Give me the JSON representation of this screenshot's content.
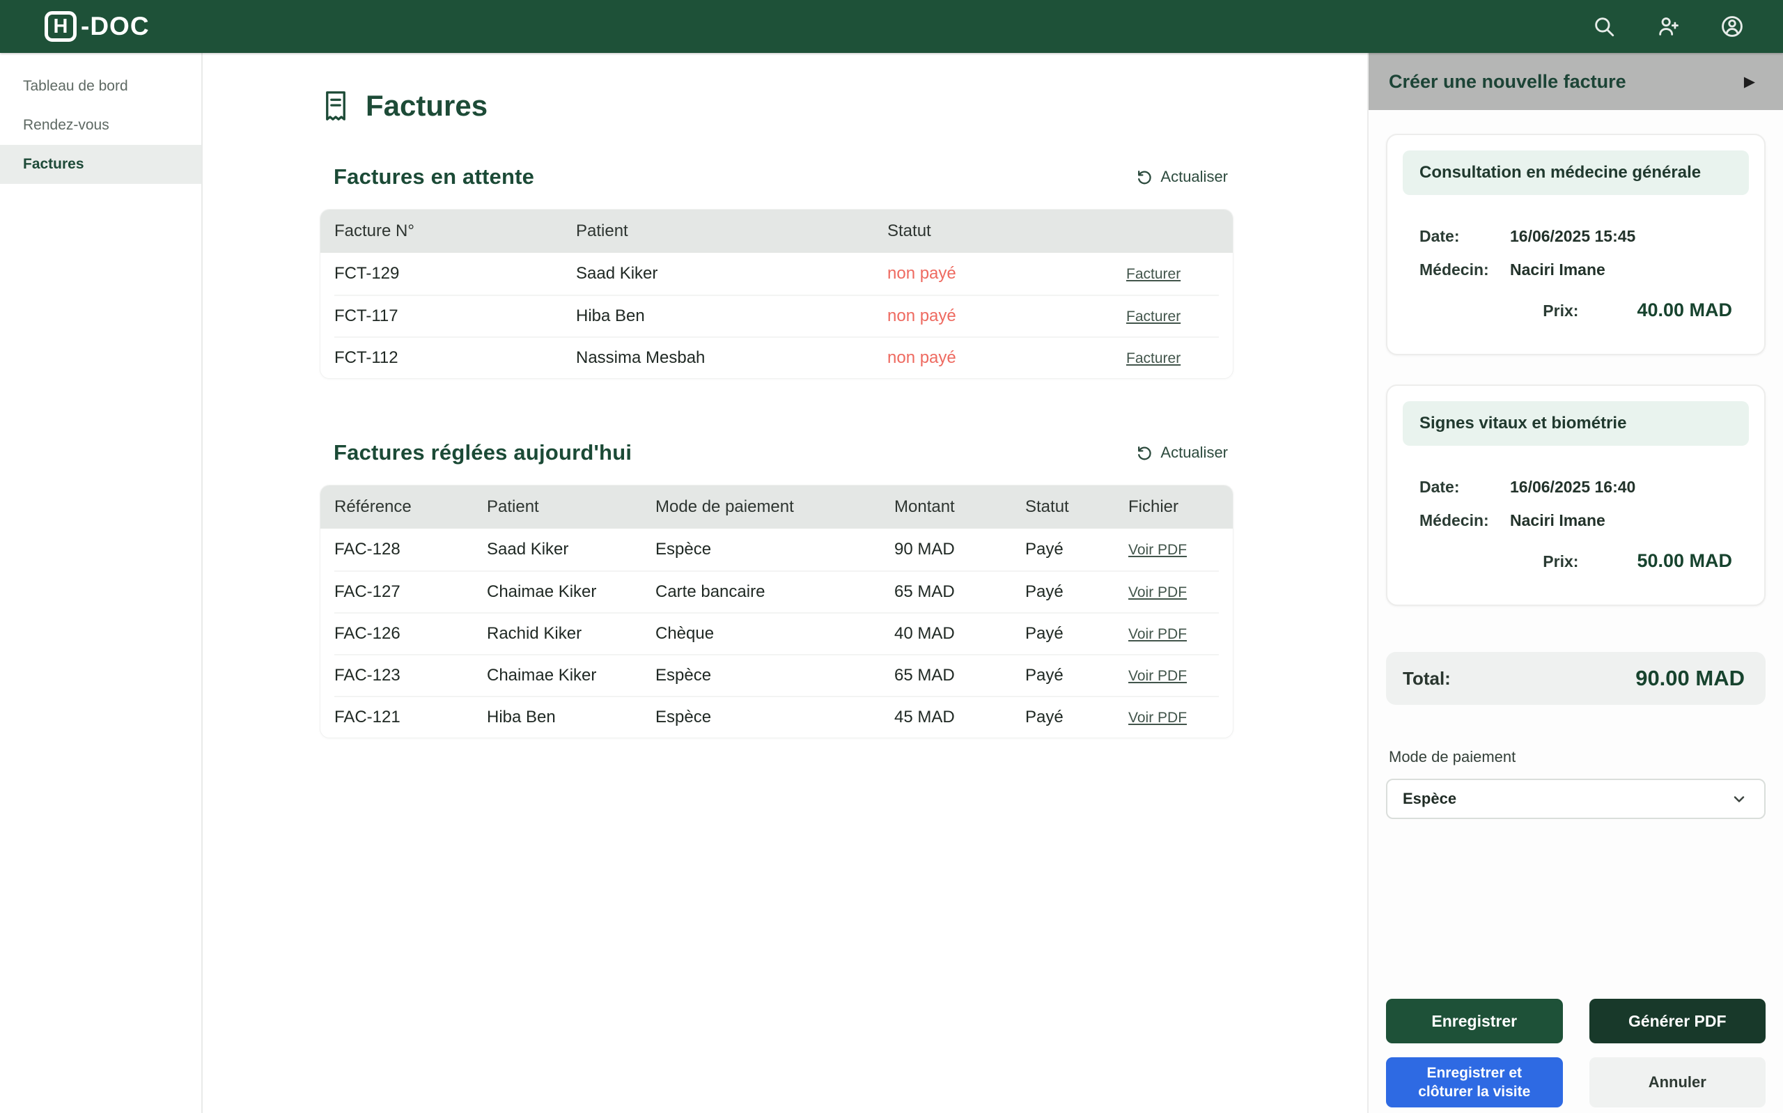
{
  "colors": {
    "header-green": "#1e5138",
    "dark-green": "#1b4a36",
    "accent-green-dark": "#17432e",
    "status-red": "#ee6a60",
    "button-blue": "#2e6ae3",
    "mint": "#e9f3ee",
    "panel-bar-gray": "#b5b6b5"
  },
  "header": {
    "logo_letter": "H",
    "logo_suffix": "-DOC",
    "icons": [
      "search-icon",
      "user-plus-icon",
      "user-circle-icon"
    ]
  },
  "sidebar": {
    "items": [
      {
        "label": "Tableau de bord",
        "active": false
      },
      {
        "label": "Rendez-vous",
        "active": false
      },
      {
        "label": "Factures",
        "active": true
      }
    ]
  },
  "main": {
    "page_title": "Factures",
    "pending": {
      "title": "Factures en attente",
      "refresh_label": "Actualiser",
      "headers": [
        "Facture N°",
        "Patient",
        "Statut"
      ],
      "rows": [
        {
          "number": "FCT-129",
          "patient": "Saad Kiker",
          "status": "non payé",
          "action": "Facturer"
        },
        {
          "number": "FCT-117",
          "patient": "Hiba Ben",
          "status": "non payé",
          "action": "Facturer"
        },
        {
          "number": "FCT-112",
          "patient": "Nassima Mesbah",
          "status": "non payé",
          "action": "Facturer"
        }
      ]
    },
    "settled": {
      "title": "Factures réglées aujourd'hui",
      "refresh_label": "Actualiser",
      "headers": [
        "Référence",
        "Patient",
        "Mode de paiement",
        "Montant",
        "Statut",
        "Fichier"
      ],
      "rows": [
        {
          "reference": "FAC-128",
          "patient": "Saad Kiker",
          "mode": "Espèce",
          "amount": "90 MAD",
          "status": "Payé",
          "file_link": "Voir PDF"
        },
        {
          "reference": "FAC-127",
          "patient": "Chaimae Kiker",
          "mode": "Carte bancaire",
          "amount": "65 MAD",
          "status": "Payé",
          "file_link": "Voir PDF"
        },
        {
          "reference": "FAC-126",
          "patient": "Rachid Kiker",
          "mode": "Chèque",
          "amount": "40 MAD",
          "status": "Payé",
          "file_link": "Voir PDF"
        },
        {
          "reference": "FAC-123",
          "patient": "Chaimae Kiker",
          "mode": "Espèce",
          "amount": "65 MAD",
          "status": "Payé",
          "file_link": "Voir PDF"
        },
        {
          "reference": "FAC-121",
          "patient": "Hiba Ben",
          "mode": "Espèce",
          "amount": "45 MAD",
          "status": "Payé",
          "file_link": "Voir PDF"
        }
      ]
    }
  },
  "panel": {
    "title": "Créer une nouvelle facture",
    "cards": [
      {
        "title": "Consultation en médecine générale",
        "date_label": "Date:",
        "date": "16/06/2025 15:45",
        "medecin_label": "Médecin:",
        "medecin": "Naciri Imane",
        "prix_label": "Prix:",
        "prix": "40.00 MAD"
      },
      {
        "title": "Signes vitaux et biométrie",
        "date_label": "Date:",
        "date": "16/06/2025 16:40",
        "medecin_label": "Médecin:",
        "medecin": "Naciri Imane",
        "prix_label": "Prix:",
        "prix": "50.00 MAD"
      }
    ],
    "total_label": "Total:",
    "total_value": "90.00 MAD",
    "payment_label": "Mode de paiement",
    "payment_selected": "Espèce",
    "buttons": {
      "save": "Enregistrer",
      "generate_pdf": "Générer PDF",
      "save_close": "Enregistrer et clôturer la visite",
      "cancel": "Annuler"
    }
  }
}
